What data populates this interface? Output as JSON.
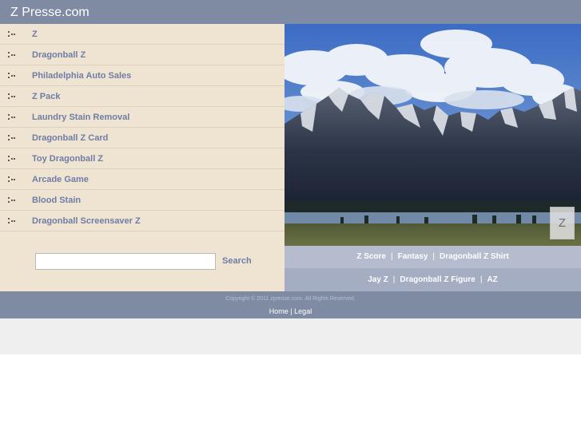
{
  "site": {
    "title": "Z Presse.com"
  },
  "links": [
    "Z",
    "Dragonball Z",
    "Philadelphia Auto Sales",
    "Z Pack",
    "Laundry Stain Removal",
    "Dragonball Z Card",
    "Toy Dragonball Z",
    "Arcade Game",
    "Blood Stain",
    "Dragonball Screensaver Z"
  ],
  "search": {
    "placeholder": "",
    "value": "",
    "button_label": "Search"
  },
  "hero": {
    "badge": "Z"
  },
  "keyword_bar_1": [
    "Z Score",
    "Fantasy",
    "Dragonball Z Shirt"
  ],
  "keyword_bar_2": [
    "Jay Z",
    "Dragonball Z Figure",
    "AZ"
  ],
  "separator": "|",
  "footer": {
    "copyright": "Copyright © 2011 zpresse.com. All Rights Reserved.",
    "home_label": "Home",
    "divider": "|",
    "legal_label": "Legal"
  },
  "colors": {
    "header_bg": "#7f8aa3",
    "sidebar_bg": "#efe4d2",
    "link": "#6f7da5",
    "keyword_bar_1_bg": "#b4bccd",
    "keyword_bar_2_bg": "#a4adc1"
  }
}
